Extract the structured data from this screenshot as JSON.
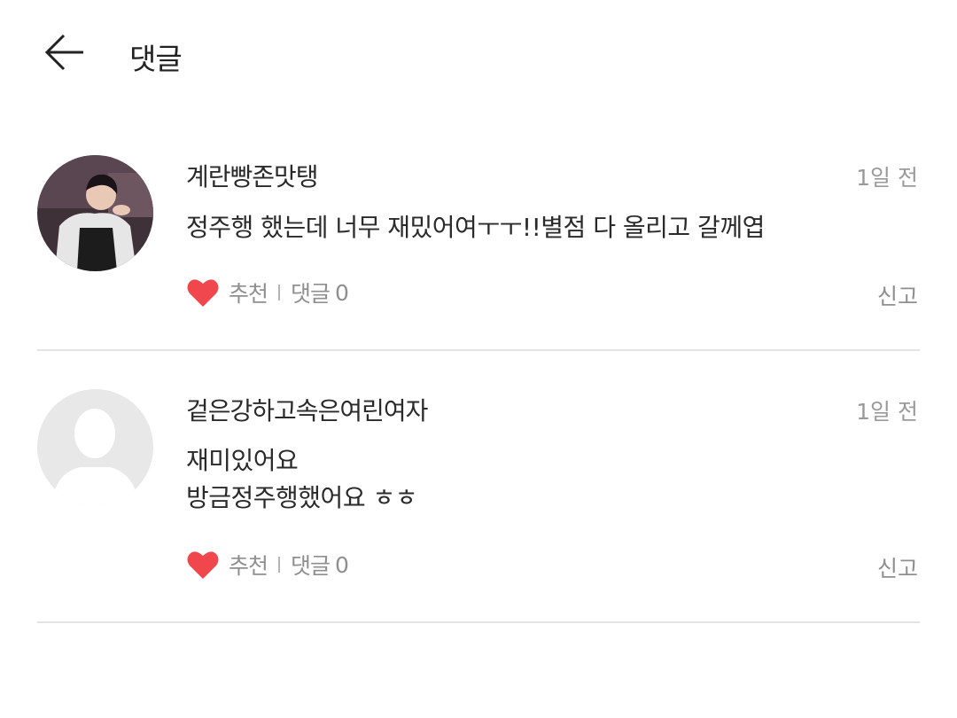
{
  "header": {
    "title": "댓글"
  },
  "comments": [
    {
      "username": "계란빵존맛탱",
      "time": "1일 전",
      "lines": [
        "정주행 했는데 너무 재밌어여ㅜㅜ!!별점 다 올리고 갈께엽"
      ],
      "like_label": "추천",
      "reply_label": "댓글",
      "reply_count": "0",
      "report_label": "신고"
    },
    {
      "username": "겉은강하고속은여린여자",
      "time": "1일 전",
      "lines": [
        "재미있어요",
        "방금정주행했어요 ㅎㅎ"
      ],
      "like_label": "추천",
      "reply_label": "댓글",
      "reply_count": "0",
      "report_label": "신고"
    }
  ],
  "colors": {
    "heart": "#f0474d",
    "muted": "#8f8f8f",
    "divider": "#e4e4e4"
  }
}
